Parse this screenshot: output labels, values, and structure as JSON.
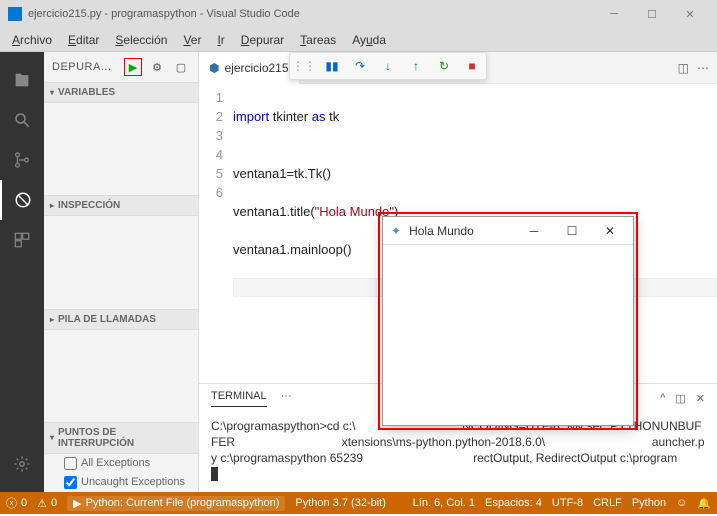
{
  "titlebar": {
    "text": "ejercicio215.py - programaspython - Visual Studio Code"
  },
  "menu": {
    "archivo": "Archivo",
    "editar": "Editar",
    "seleccion": "Selección",
    "ver": "Ver",
    "ir": "Ir",
    "depurar": "Depurar",
    "tareas": "Tareas",
    "ayuda": "Ayuda"
  },
  "sidebar": {
    "header_title": "DEPURA...",
    "sections": {
      "variables": "VARIABLES",
      "inspeccion": "INSPECCIÓN",
      "pila": "PILA DE LLAMADAS",
      "puntos": "PUNTOS DE INTERRUPCIÓN"
    },
    "breakpoints": {
      "all": "All Exceptions",
      "uncaught": "Uncaught Exceptions"
    }
  },
  "tab": {
    "filename": "ejercicio215"
  },
  "code": {
    "line1_import": "import",
    "line1_mod": " tkinter ",
    "line1_as": "as",
    "line1_alias": " tk",
    "line2": "",
    "line3": "ventana1=tk.Tk()",
    "line4a": "ventana1.title(",
    "line4b": "\"Hola Mundo\"",
    "line4c": ")",
    "line5": "ventana1.mainloop()",
    "gutters": [
      "1",
      "2",
      "3",
      "4",
      "5",
      "6"
    ]
  },
  "terminal": {
    "tab": "TERMINAL",
    "more": "···",
    "body": "C:\\programaspython>cd c:\\                                NCODING=UTF-8\" && set \"PYTHONUNBUFFER                                xtensions\\ms-python.python-2018.6.0\\                                auncher.py c:\\programaspython 65239                                 rectOutput, RedirectOutput c:\\program\n"
  },
  "status": {
    "errors": "0",
    "warnings": "0",
    "debug": "Python: Current File (programaspython)",
    "interpreter": "Python 3.7 (32-bit)",
    "pos": "Lín. 6, Col. 1",
    "spaces": "Espacios: 4",
    "enc": "UTF-8",
    "eol": "CRLF",
    "lang": "Python"
  },
  "tkwindow": {
    "title": "Hola Mundo"
  }
}
